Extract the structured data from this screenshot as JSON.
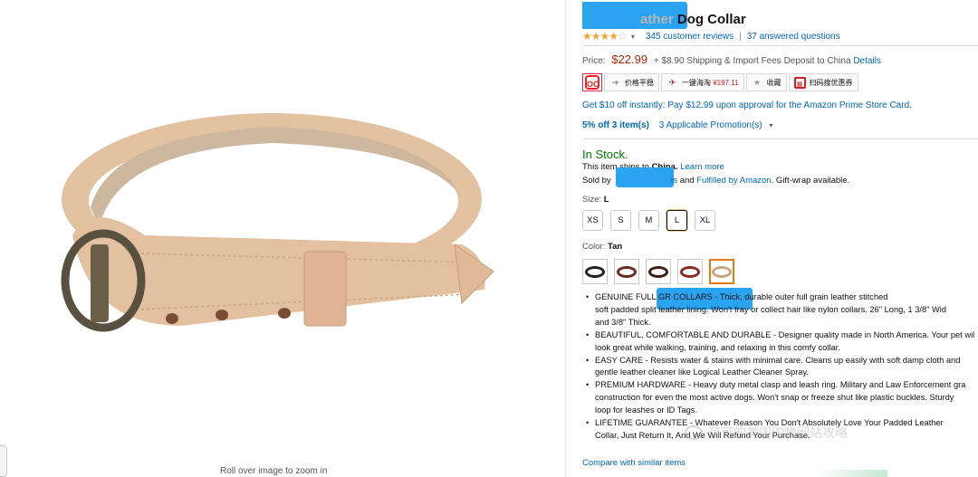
{
  "product": {
    "title_faded": "ather",
    "title_main": "Dog Collar",
    "rating_stars": 4,
    "reviews_link": "345 customer reviews",
    "questions_link": "37 answered questions"
  },
  "price": {
    "label": "Price:",
    "value": "$22.99",
    "shipping": "+ $8.90 Shipping & Import Fees Deposit to China",
    "details_link": "Details"
  },
  "plugin_bar": {
    "logo_text": "OO",
    "price_trend": "价格平稳",
    "one_click": "一键海淘",
    "one_click_price": "¥197.11",
    "favorite": "收藏",
    "coupon": "扫码搜优惠券"
  },
  "promo": {
    "prime_card": "Get $10 off instantly: Pay $12.99 upon approval for the Amazon Prime Store Card.",
    "discount": "5% off 3 item(s)",
    "applicable": "3 Applicable Promotion(s)"
  },
  "availability": {
    "stock": "In Stock.",
    "ships_prefix": "This item ships to",
    "ships_country": "China.",
    "learn_more": "Learn more",
    "sold_by": "Sold by",
    "seller_tail": "ts",
    "fulfilled_and": "and",
    "fulfilled_link": "Fulfilled by Amazon",
    "giftwrap": ". Gift-wrap available."
  },
  "size": {
    "label": "Size:",
    "selected": "L",
    "options": [
      "XS",
      "S",
      "M",
      "L",
      "XL"
    ]
  },
  "color": {
    "label": "Color:",
    "selected": "Tan",
    "swatch_colors": [
      "#222222",
      "#6b2a1f",
      "#3a1d14",
      "#8a2a22",
      "#c9a57c"
    ]
  },
  "bullets": [
    "GENUINE FULL GR                              COLLARS - Thick, durable outer full grain leather stitched",
    "soft padded split leather lining. Won't fray or collect hair like nylon collars. 26\" Long, 1 3/8\" Wid",
    "and 3/8\" Thick.",
    "BEAUTIFUL, COMFORTABLE AND DURABLE - Designer quality made in North America. Your pet wil",
    "look great while walking, training, and relaxing in this comfy collar.",
    "EASY CARE - Resists water & stains with minimal care. Cleans up easily with soft damp cloth and",
    "gentle leather cleaner like Logical Leather Cleaner Spray.",
    "PREMIUM HARDWARE - Heavy duty metal clasp and leash ring. Military and Law Enforcement gra",
    "construction for even the most active dogs. Won't snap or freeze shut like plastic buckles. Sturdy",
    "loop for leashes or ID Tags.",
    "LIFETIME GUARANTEE -   Whatever Reason You Don't Absolutely Love Your Padded Leather",
    "Collar, Just Return It, And We Will Refund Your Purchase."
  ],
  "bullet_first_flags": [
    true,
    false,
    false,
    true,
    false,
    true,
    false,
    true,
    false,
    false,
    true,
    false
  ],
  "compare_link": "Compare with similar items",
  "zoom_hint": "Roll over image to zoom in",
  "watermark": "可可的美国购物网站攻略"
}
